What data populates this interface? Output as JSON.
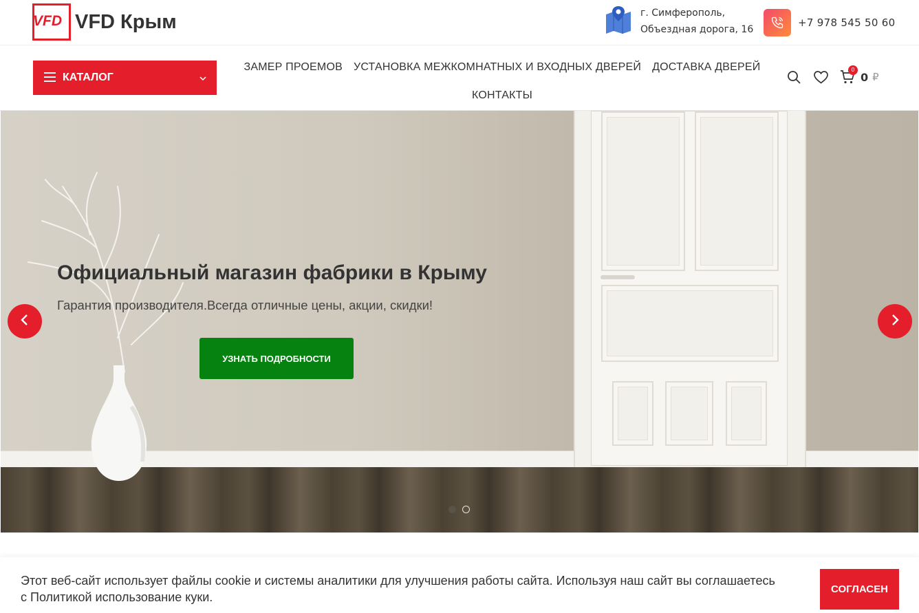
{
  "header": {
    "logo_mark": "VFD",
    "logo_text": "VFD Крым",
    "address_line1": "г. Симферополь,",
    "address_line2": "Объездная дорога, 16",
    "phone": "+7 978 545 50 60"
  },
  "nav": {
    "catalog_label": "КАТАЛОГ",
    "menu": [
      "ЗАМЕР ПРОЕМОВ",
      "УСТАНОВКА МЕЖКОМНАТНЫХ И ВХОДНЫХ ДВЕРЕЙ",
      "ДОСТАВКА ДВЕРЕЙ",
      "КОНТАКТЫ"
    ],
    "cart_count": "0",
    "cart_total": "0",
    "cart_currency": "₽"
  },
  "hero": {
    "title": "Официальный магазин фабрики в Крыму",
    "subtitle": "Гарантия производителя.Всегда отличные цены, акции, скидки!",
    "button_label": "УЗНАТЬ ПОДРОБНОСТИ",
    "slide_count": 2,
    "active_slide": 1
  },
  "cookie": {
    "text": "Этот веб-сайт использует файлы cookie и системы аналитики для улучшения работы сайта. Используя наш сайт вы соглашаетесь с Политикой использование куки.",
    "accept_label": "СОГЛАСЕН"
  },
  "icons": {
    "map": "map-pin-icon",
    "phone": "phone-icon",
    "menu": "hamburger-icon",
    "chevron": "chevron-down-icon",
    "search": "search-icon",
    "wishlist": "heart-icon",
    "cart": "cart-icon",
    "prev": "arrow-left-icon",
    "next": "arrow-right-icon"
  },
  "colors": {
    "brand_red": "#e41e2b",
    "cta_green": "#068210",
    "phone_gradient_start": "#f24b6a",
    "phone_gradient_end": "#ff8a3a"
  }
}
